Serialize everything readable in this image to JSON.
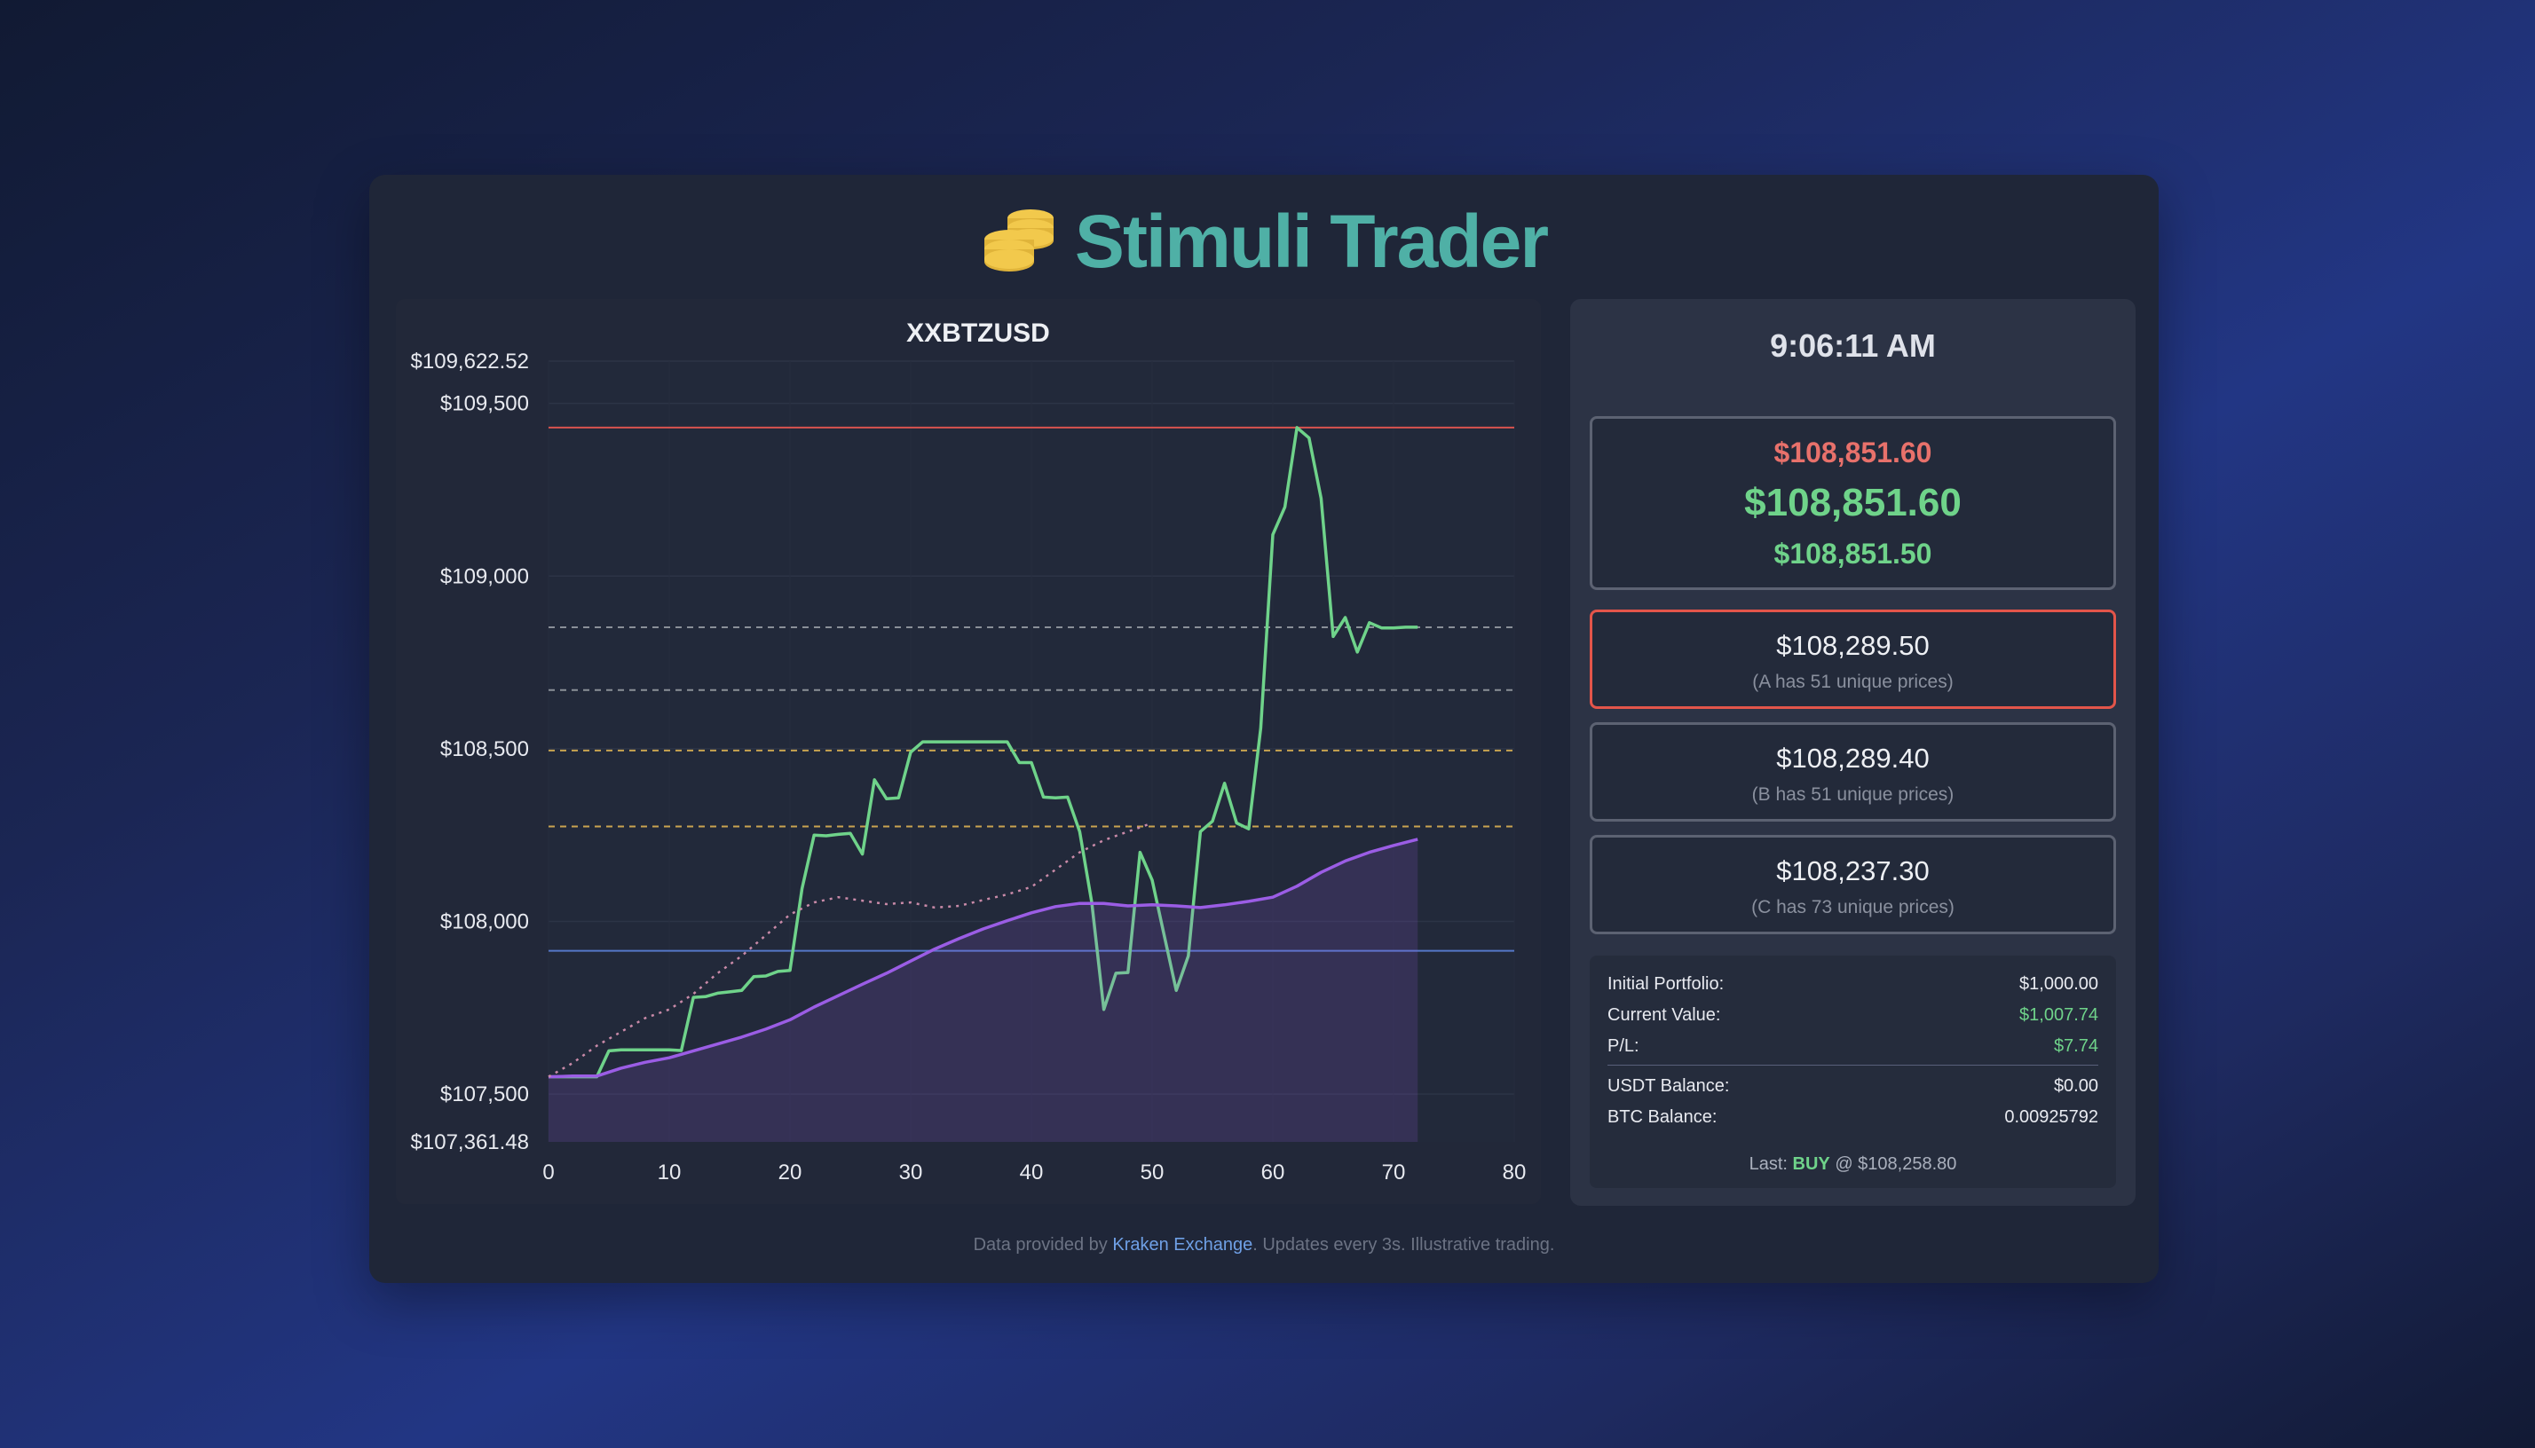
{
  "app": {
    "title": "Stimuli Trader",
    "logo_icon": "coins-stack-icon"
  },
  "colors": {
    "accent": "#4fb0a6",
    "up": "#6fd38a",
    "down": "#e8716b",
    "level_a_border": "#e3554a",
    "sma": "#9b5de5",
    "logo_gold": "#f2c94c"
  },
  "side": {
    "clock": "9:06:11 AM",
    "quote": {
      "ask": "$108,851.60",
      "mid": "$108,851.60",
      "bid": "$108,851.50"
    },
    "levels": [
      {
        "price": "$108,289.50",
        "note": "(A has 51 unique prices)"
      },
      {
        "price": "$108,289.40",
        "note": "(B has 51 unique prices)"
      },
      {
        "price": "$108,237.30",
        "note": "(C has 73 unique prices)"
      }
    ],
    "stats": {
      "initial_label": "Initial Portfolio:",
      "initial_value": "$1,000.00",
      "current_label": "Current Value:",
      "current_value": "$1,007.74",
      "pl_label": "P/L:",
      "pl_value": "$7.74",
      "usdt_label": "USDT Balance:",
      "usdt_value": "$0.00",
      "btc_label": "BTC Balance:",
      "btc_value": "0.00925792",
      "last_prefix": "Last:",
      "last_action": "BUY",
      "last_price": "@ $108,258.80"
    }
  },
  "footer": {
    "prefix": "Data provided by",
    "link": "Kraken Exchange",
    "suffix": ". Updates every 3s. Illustrative trading."
  },
  "chart_data": {
    "type": "line",
    "title": "XXBTZUSD",
    "xlim": [
      0,
      80
    ],
    "ylim": [
      107361.48,
      109622.52
    ],
    "x_ticks": [
      0,
      10,
      20,
      30,
      40,
      50,
      60,
      70,
      80
    ],
    "y_ticks": [
      107500,
      108000,
      108500,
      109000,
      109500
    ],
    "y_tick_labels": [
      "$107,500",
      "$108,000",
      "$108,500",
      "$109,000",
      "$109,500"
    ],
    "y_min_label": "$107,361.48",
    "y_max_label": "$109,622.52",
    "grid": true,
    "series": [
      {
        "role": "price",
        "color": "#6fd38a",
        "style": "solid",
        "x": [
          0,
          4,
          5,
          6,
          7,
          8,
          9,
          10,
          11,
          12,
          13,
          14,
          15,
          16,
          17,
          18,
          19,
          20,
          21,
          22,
          23,
          24,
          25,
          26,
          27,
          28,
          29,
          30,
          31,
          32,
          33,
          34,
          35,
          36,
          37,
          38,
          39,
          40,
          41,
          42,
          43,
          44,
          45,
          46,
          47,
          48,
          49,
          50,
          51,
          52,
          53,
          54,
          55,
          56,
          57,
          58,
          59,
          60,
          61,
          62,
          63,
          64,
          65,
          66,
          67,
          68,
          69,
          70,
          71,
          72
        ],
        "y": [
          107550,
          107550,
          107625,
          107628,
          107628,
          107628,
          107628,
          107628,
          107626,
          107780,
          107782,
          107792,
          107796,
          107800,
          107840,
          107842,
          107855,
          107858,
          108095,
          108250,
          108248,
          108252,
          108255,
          108195,
          108410,
          108355,
          108358,
          108490,
          108520,
          108520,
          108520,
          108520,
          108520,
          108520,
          108520,
          108520,
          108460,
          108460,
          108360,
          108358,
          108360,
          108260,
          108055,
          107745,
          107850,
          107852,
          108200,
          108120,
          107960,
          107800,
          107900,
          108260,
          108290,
          108400,
          108285,
          108268,
          108560,
          109120,
          109200,
          109430,
          109400,
          109225,
          108825,
          108880,
          108780,
          108865,
          108850,
          108850,
          108852,
          108852
        ]
      },
      {
        "role": "moving-average",
        "color": "#9b5de5",
        "style": "solid-filled",
        "x": [
          0,
          2,
          4,
          6,
          8,
          10,
          12,
          14,
          16,
          18,
          20,
          22,
          24,
          26,
          28,
          30,
          32,
          34,
          36,
          38,
          40,
          42,
          44,
          46,
          48,
          50,
          52,
          54,
          56,
          58,
          60,
          62,
          64,
          66,
          68,
          70,
          72
        ],
        "y": [
          107550,
          107552,
          107552,
          107575,
          107592,
          107605,
          107625,
          107645,
          107665,
          107688,
          107715,
          107752,
          107785,
          107818,
          107850,
          107885,
          107920,
          107950,
          107978,
          108002,
          108025,
          108043,
          108052,
          108052,
          108045,
          108048,
          108045,
          108040,
          108048,
          108058,
          108070,
          108102,
          108142,
          108175,
          108200,
          108220,
          108238
        ]
      },
      {
        "role": "trend",
        "color": "#c98aa8",
        "style": "dotted",
        "x": [
          0,
          2,
          4,
          6,
          8,
          10,
          12,
          14,
          16,
          18,
          20,
          22,
          24,
          26,
          28,
          30,
          32,
          34,
          36,
          38,
          40,
          42,
          44,
          46,
          48,
          50
        ],
        "y": [
          107550,
          107590,
          107640,
          107680,
          107720,
          107745,
          107790,
          107850,
          107900,
          107960,
          108020,
          108055,
          108070,
          108060,
          108050,
          108055,
          108040,
          108045,
          108062,
          108078,
          108100,
          108150,
          108200,
          108235,
          108260,
          108285
        ]
      }
    ],
    "hlines": [
      {
        "y": 109430,
        "color": "#d9534f",
        "style": "solid"
      },
      {
        "y": 108851.6,
        "color": "#8a9098",
        "style": "dashed"
      },
      {
        "y": 108670,
        "color": "#8a9098",
        "style": "dashed"
      },
      {
        "y": 108495,
        "color": "#c9a450",
        "style": "dashed"
      },
      {
        "y": 108275,
        "color": "#c9a450",
        "style": "dashed"
      },
      {
        "y": 107915,
        "color": "#5577c8",
        "style": "solid"
      }
    ]
  }
}
